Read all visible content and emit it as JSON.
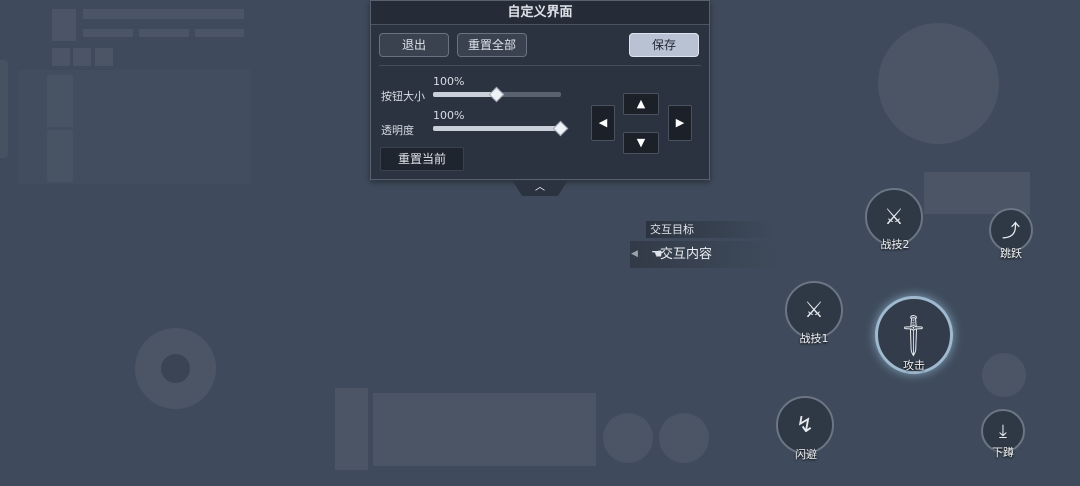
{
  "panel": {
    "title": "自定义界面",
    "exit_label": "退出",
    "reset_all_label": "重置全部",
    "save_label": "保存",
    "size_label": "按钮大小",
    "size_value": "100%",
    "size_level": 0.5,
    "opacity_label": "透明度",
    "opacity_value": "100%",
    "opacity_level": 1.0,
    "reset_current_label": "重置当前",
    "arrows": {
      "up": "▲",
      "down": "▼",
      "left": "◀",
      "right": "▶"
    },
    "collapse_glyph": "︿"
  },
  "interaction": {
    "target_label": "交互目标",
    "content_label": "交互内容",
    "icon": "hand-icon"
  },
  "skills": {
    "skill2_label": "战技2",
    "jump_label": "跳跃",
    "skill1_label": "战技1",
    "attack_label": "攻击",
    "dodge_label": "闪避",
    "crouch_label": "下蹲"
  },
  "colors": {
    "background": "#3f4b5c",
    "panel": "#2b3340",
    "save_button": "#b8c2d2",
    "attack_glow": "#9fb9cf"
  }
}
